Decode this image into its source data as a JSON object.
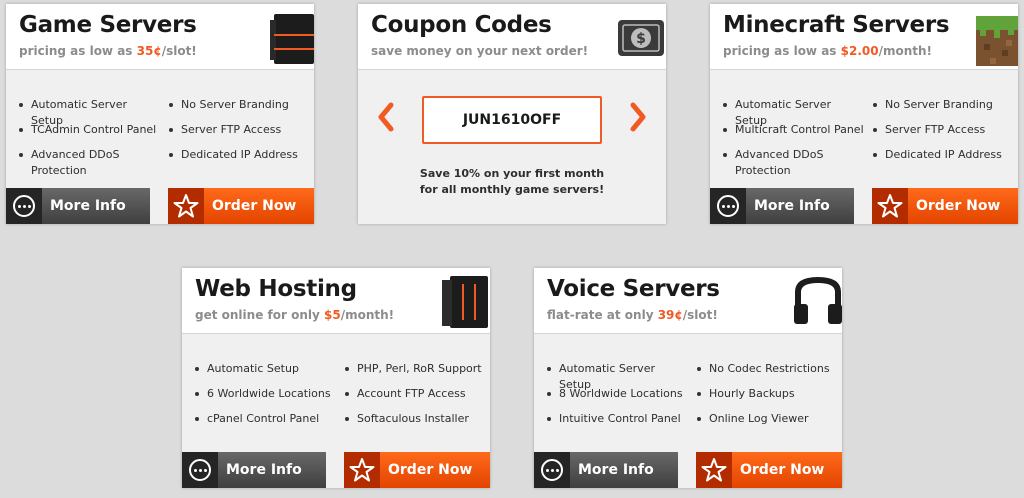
{
  "cards": [
    {
      "title": "Game Servers",
      "subtitle_pre": "pricing as low as ",
      "price": "35¢",
      "subtitle_post": "/slot!",
      "features": [
        "Automatic Server Setup",
        "No Server Branding",
        "TCAdmin Control Panel",
        "Server FTP Access",
        "Advanced DDoS Protection",
        "Dedicated IP Address"
      ],
      "more_label": "More Info",
      "order_label": "Order Now",
      "icon": "server-rack-icon"
    },
    {
      "title": "Coupon Codes",
      "subtitle": "save money on your next order!",
      "code": "JUN1610OFF",
      "desc_line1": "Save 10% on your first month",
      "desc_line2": "for all monthly game servers!",
      "icon": "dollar-bill-icon"
    },
    {
      "title": "Minecraft Servers",
      "subtitle_pre": "pricing as low as ",
      "price": "$2.00",
      "subtitle_post": "/month!",
      "features": [
        "Automatic Server Setup",
        "No Server Branding",
        "Multicraft Control Panel",
        "Server FTP Access",
        "Advanced DDoS Protection",
        "Dedicated IP Address"
      ],
      "more_label": "More Info",
      "order_label": "Order Now",
      "icon": "minecraft-grass-block-icon"
    },
    {
      "title": "Web Hosting",
      "subtitle_pre": "get online for only ",
      "price": "$5",
      "subtitle_post": "/month!",
      "features": [
        "Automatic Setup",
        "PHP, Perl, RoR Support",
        "6 Worldwide Locations",
        "Account FTP Access",
        "cPanel Control Panel",
        "Softaculous Installer"
      ],
      "more_label": "More Info",
      "order_label": "Order Now",
      "icon": "server-tower-icon"
    },
    {
      "title": "Voice Servers",
      "subtitle_pre": "flat-rate at only ",
      "price": "39¢",
      "subtitle_post": "/slot!",
      "features": [
        "Automatic Server Setup",
        "No Codec Restrictions",
        "8 Worldwide Locations",
        "Hourly Backups",
        "Intuitive Control Panel",
        "Online Log Viewer"
      ],
      "more_label": "More Info",
      "order_label": "Order Now",
      "icon": "headset-icon"
    }
  ],
  "colors": {
    "accent": "#f15a22",
    "background": "#dcdcdc",
    "card": "#f0f0f0"
  }
}
